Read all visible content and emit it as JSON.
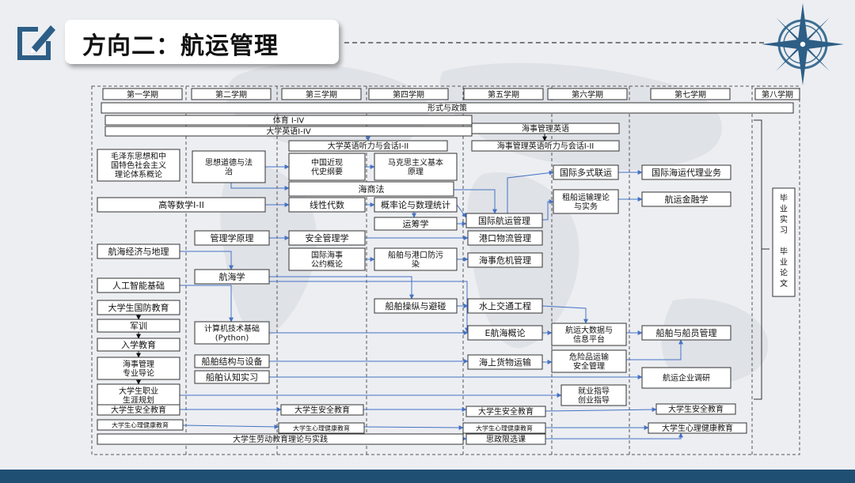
{
  "page": {
    "title": "方向二：航运管理"
  },
  "semesters": [
    "第一学期",
    "第二学期",
    "第三学期",
    "第四学期",
    "第五学期",
    "第六学期",
    "第七学期",
    "第八学期"
  ],
  "courses": [
    {
      "id": "xszc",
      "label": [
        "形式与政策"
      ]
    },
    {
      "id": "ty",
      "label": [
        "体育 I-IV"
      ]
    },
    {
      "id": "dxyy",
      "label": [
        "大学英语I-IV"
      ]
    },
    {
      "id": "hsglyy",
      "label": [
        "海事管理英语"
      ]
    },
    {
      "id": "dxyytl",
      "label": [
        "大学英语听力与会话I-II"
      ]
    },
    {
      "id": "hsglyytl",
      "label": [
        "海事管理英语听力与会话I-II"
      ]
    },
    {
      "id": "mzd",
      "label": [
        "毛泽东思想和中",
        "国特色社会主义",
        "理论体系概论"
      ]
    },
    {
      "id": "sxdd",
      "label": [
        "思想道德与法",
        "治"
      ]
    },
    {
      "id": "zgjd",
      "label": [
        "中国近现",
        "代史纲要"
      ]
    },
    {
      "id": "mks",
      "label": [
        "马克思主义基本",
        "原理"
      ]
    },
    {
      "id": "gjdslh",
      "label": [
        "国际多式联运"
      ]
    },
    {
      "id": "gjhsdl",
      "label": [
        "国际海运代理业务"
      ]
    },
    {
      "id": "hsf",
      "label": [
        "海商法"
      ]
    },
    {
      "id": "zcys",
      "label": [
        "租船运输理论",
        "与实务"
      ]
    },
    {
      "id": "hyjrx",
      "label": [
        "航运金融学"
      ]
    },
    {
      "id": "gdsx",
      "label": [
        "高等数学I-II"
      ]
    },
    {
      "id": "xxds",
      "label": [
        "线性代数"
      ]
    },
    {
      "id": "gll",
      "label": [
        "概率论与数理统计"
      ]
    },
    {
      "id": "gjhygl",
      "label": [
        "国际航运管理"
      ]
    },
    {
      "id": "ycx",
      "label": [
        "运筹学"
      ]
    },
    {
      "id": "glxyl",
      "label": [
        "管理学原理"
      ]
    },
    {
      "id": "aqglx",
      "label": [
        "安全管理学"
      ]
    },
    {
      "id": "gkwl",
      "label": [
        "港口物流管理"
      ]
    },
    {
      "id": "hhjj",
      "label": [
        "航海经济与地理"
      ]
    },
    {
      "id": "gjhsgy",
      "label": [
        "国际海事",
        "公约概论"
      ]
    },
    {
      "id": "cbgk",
      "label": [
        "船舶与港口防污",
        "染"
      ]
    },
    {
      "id": "hswj",
      "label": [
        "海事危机管理"
      ]
    },
    {
      "id": "rgzn",
      "label": [
        "人工智能基础"
      ]
    },
    {
      "id": "hhx",
      "label": [
        "航海学"
      ]
    },
    {
      "id": "gfjy",
      "label": [
        "大学生国防教育"
      ]
    },
    {
      "id": "cbczby",
      "label": [
        "船舶操纵与避碰"
      ]
    },
    {
      "id": "ssjt",
      "label": [
        "水上交通工程"
      ]
    },
    {
      "id": "jx",
      "label": [
        "军训"
      ]
    },
    {
      "id": "jsj",
      "label": [
        "计算机技术基础",
        "(Python)"
      ]
    },
    {
      "id": "ehh",
      "label": [
        "E航海概论"
      ]
    },
    {
      "id": "hysj",
      "label": [
        "航运大数据与",
        "信息平台"
      ]
    },
    {
      "id": "cbcy",
      "label": [
        "船舶与船员管理"
      ]
    },
    {
      "id": "rxjy",
      "label": [
        "入学教育"
      ]
    },
    {
      "id": "hsgl",
      "label": [
        "海事管理",
        "专业导论"
      ]
    },
    {
      "id": "cbjg",
      "label": [
        "船舶结构与设备"
      ]
    },
    {
      "id": "hshw",
      "label": [
        "海上货物运输"
      ]
    },
    {
      "id": "wxp",
      "label": [
        "危险品运输",
        "安全管理"
      ]
    },
    {
      "id": "cbrz",
      "label": [
        "船舶认知实习"
      ]
    },
    {
      "id": "hyqy",
      "label": [
        "航运企业调研"
      ]
    },
    {
      "id": "zygh",
      "label": [
        "大学生职业",
        "生涯规划"
      ]
    },
    {
      "id": "jyzd",
      "label": [
        "就业指导",
        "创业指导"
      ]
    },
    {
      "id": "aq1",
      "label": [
        "大学生安全教育"
      ]
    },
    {
      "id": "aq3",
      "label": [
        "大学生安全教育"
      ]
    },
    {
      "id": "aq5",
      "label": [
        "大学生安全教育"
      ]
    },
    {
      "id": "aq7",
      "label": [
        "大学生安全教育"
      ]
    },
    {
      "id": "xl1",
      "label": [
        "大学生心理健康教育"
      ]
    },
    {
      "id": "xl3",
      "label": [
        "大学生心理健康教育"
      ]
    },
    {
      "id": "xl5",
      "label": [
        "大学生心理健康教育"
      ]
    },
    {
      "id": "xl7",
      "label": [
        "大学生心理健康教育"
      ]
    },
    {
      "id": "ldjy",
      "label": [
        "大学生劳动教育理论与实践"
      ]
    },
    {
      "id": "szxx",
      "label": [
        "思政限选课"
      ]
    },
    {
      "id": "bysx",
      "label": [
        "毕",
        "业",
        "实",
        "习",
        "",
        "毕",
        "业",
        "论",
        "文"
      ]
    }
  ]
}
